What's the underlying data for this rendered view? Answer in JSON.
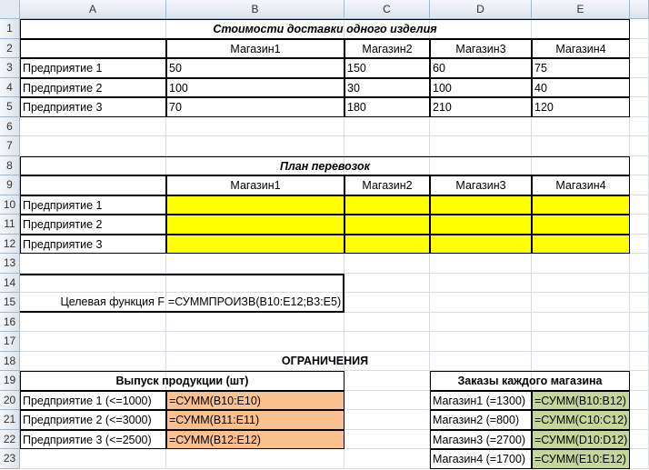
{
  "columns": [
    "A",
    "B",
    "C",
    "D",
    "E"
  ],
  "rows": [
    "1",
    "2",
    "3",
    "4",
    "5",
    "6",
    "7",
    "8",
    "9",
    "10",
    "11",
    "12",
    "13",
    "14",
    "15",
    "16",
    "17",
    "18",
    "19",
    "20",
    "21",
    "22",
    "23"
  ],
  "table1": {
    "title": "Стоимости доставки одного изделия",
    "headers": [
      "Магазин1",
      "Магазин2",
      "Магазин3",
      "Магазин4"
    ],
    "rows": [
      {
        "label": "Предприятие 1",
        "values": [
          "50",
          "150",
          "60",
          "75"
        ]
      },
      {
        "label": "Предприятие 2",
        "values": [
          "100",
          "30",
          "100",
          "40"
        ]
      },
      {
        "label": "Предприятие 3",
        "values": [
          "70",
          "180",
          "210",
          "120"
        ]
      }
    ]
  },
  "table2": {
    "title": "План перевозок",
    "headers": [
      "Магазин1",
      "Магазин2",
      "Магазин3",
      "Магазин4"
    ],
    "rows": [
      "Предприятие 1",
      "Предприятие 2",
      "Предприятие 3"
    ]
  },
  "objective": {
    "label": "Целевая функция  F",
    "formula": "=СУММПРОИЗВ(B10:E12;B3:E5)"
  },
  "constraints_title": "ОГРАНИЧЕНИЯ",
  "production": {
    "title": "Выпуск продукции (шт)",
    "rows": [
      {
        "label": "Предприятие 1 (<=1000)",
        "formula": "=СУММ(B10:E10)"
      },
      {
        "label": "Предприятие 2 (<=3000)",
        "formula": "=СУММ(B11:E11)"
      },
      {
        "label": "Предприятие 3 (<=2500)",
        "formula": "=СУММ(B12:E12)"
      }
    ]
  },
  "orders": {
    "title": "Заказы каждого магазина",
    "rows": [
      {
        "label": "Магазин1 (=1300)",
        "formula": "=СУММ(B10:B12)"
      },
      {
        "label": "Магазин2   (=800)",
        "formula": "=СУММ(C10:C12)"
      },
      {
        "label": "Магазин3 (=2700)",
        "formula": "=СУММ(D10:D12)"
      },
      {
        "label": "Магазин4 (=1700)",
        "formula": "=СУММ(E10:E12)"
      }
    ]
  },
  "colors": {
    "yellow": "#ffff00",
    "orange": "#fac090",
    "green": "#c4d79b",
    "header_bg": "#dde3ec"
  }
}
